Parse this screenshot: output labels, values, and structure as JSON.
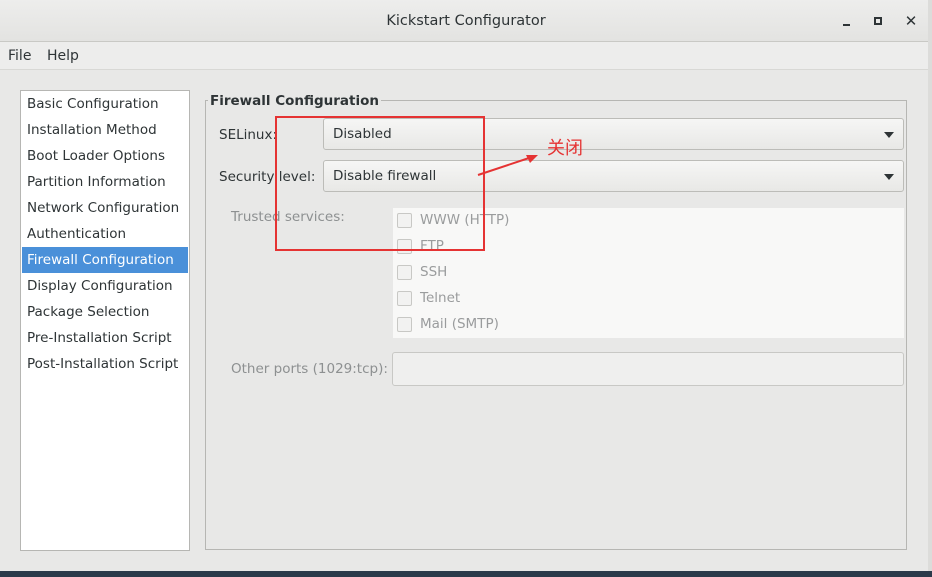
{
  "window": {
    "title": "Kickstart Configurator",
    "controls": {
      "minimize": "minimize",
      "maximize": "maximize",
      "close": "✕"
    }
  },
  "menubar": {
    "file": "File",
    "help": "Help"
  },
  "sidebar": {
    "items": [
      {
        "label": "Basic Configuration",
        "selected": false
      },
      {
        "label": "Installation Method",
        "selected": false
      },
      {
        "label": "Boot Loader Options",
        "selected": false
      },
      {
        "label": "Partition Information",
        "selected": false
      },
      {
        "label": "Network Configuration",
        "selected": false
      },
      {
        "label": "Authentication",
        "selected": false
      },
      {
        "label": "Firewall Configuration",
        "selected": true
      },
      {
        "label": "Display Configuration",
        "selected": false
      },
      {
        "label": "Package Selection",
        "selected": false
      },
      {
        "label": "Pre-Installation Script",
        "selected": false
      },
      {
        "label": "Post-Installation Script",
        "selected": false
      }
    ]
  },
  "firewall": {
    "frame_title": "Firewall Configuration",
    "selinux": {
      "label": "SELinux:",
      "value": "Disabled"
    },
    "security_level": {
      "label": "Security level:",
      "value": "Disable firewall"
    },
    "trusted_services": {
      "label": "Trusted services:",
      "items": [
        {
          "label": "WWW (HTTP)",
          "checked": false
        },
        {
          "label": "FTP",
          "checked": false
        },
        {
          "label": "SSH",
          "checked": false
        },
        {
          "label": "Telnet",
          "checked": false
        },
        {
          "label": "Mail (SMTP)",
          "checked": false
        }
      ]
    },
    "other_ports": {
      "label": "Other ports (1029:tcp):",
      "value": ""
    }
  },
  "annotation": {
    "text": "关闭",
    "color": "#e53333"
  },
  "colors": {
    "selection": "#4a90d9",
    "annotation": "#e53333"
  }
}
